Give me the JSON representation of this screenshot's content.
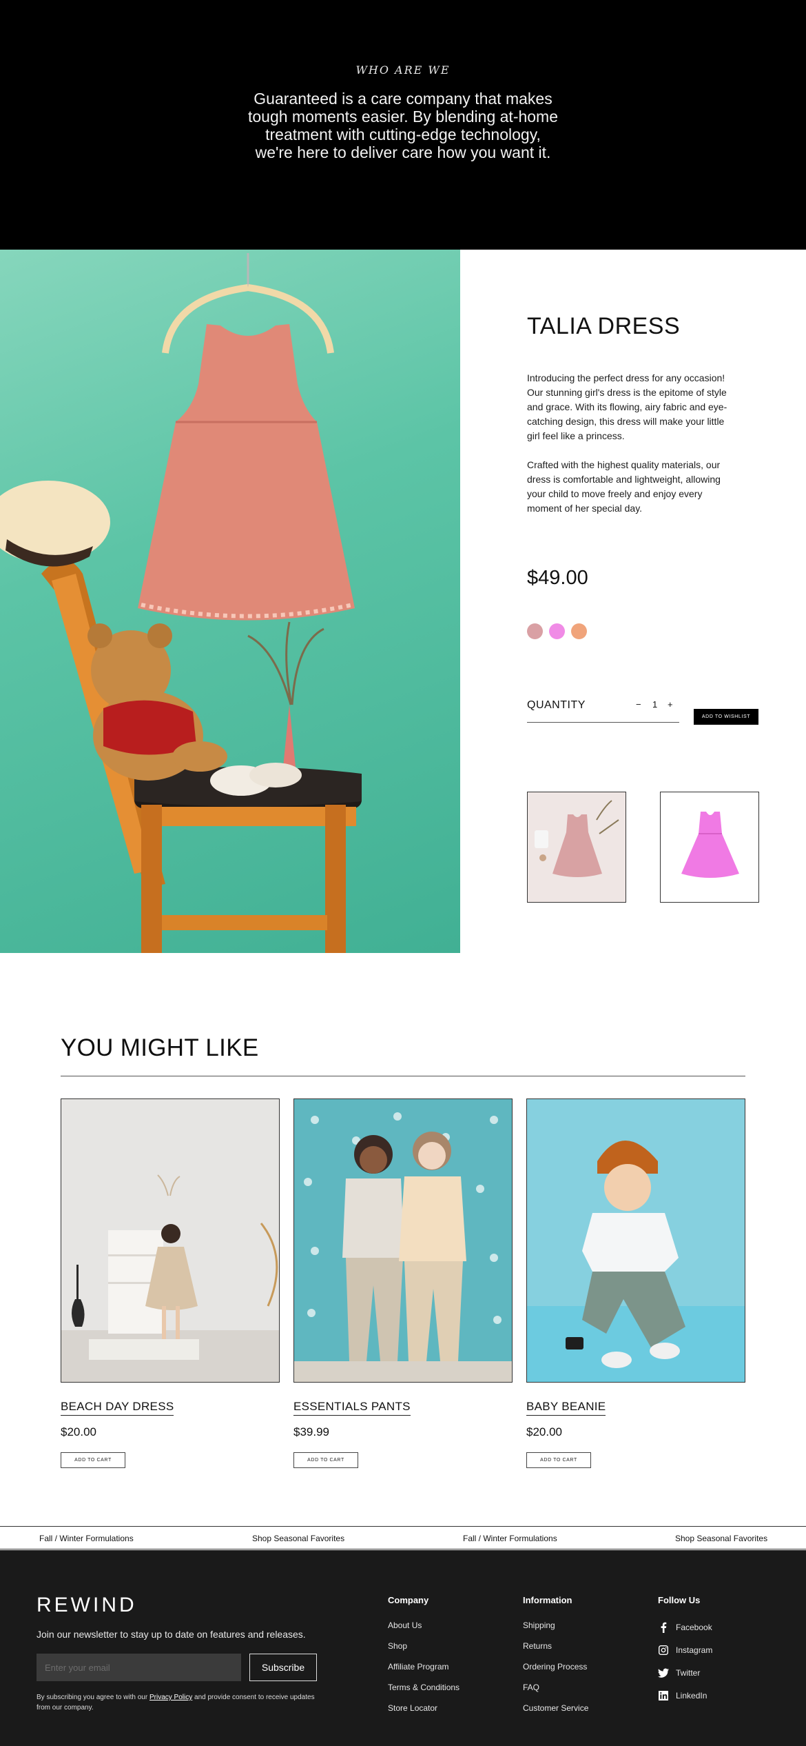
{
  "hero": {
    "eyebrow": "WHO ARE WE",
    "lead": "Guaranteed is a care company that makes tough moments easier. By blending at-home treatment with cutting-edge technology, we're here to deliver care how you want it."
  },
  "product": {
    "title": "TALIA DRESS",
    "description": [
      "Introducing the perfect dress for any occasion! Our stunning girl's dress is the epitome of style and grace. With its flowing, airy fabric and eye-catching design, this dress will make your little girl feel like a princess.",
      "Crafted with the highest quality materials, our dress is comfortable and lightweight, allowing your child to move freely and enjoy every moment of her special day."
    ],
    "price": "$49.00",
    "swatches": [
      "#d9a0a4",
      "#f08be6",
      "#f0a47b"
    ],
    "quantity_label": "QUANTITY",
    "quantity_minus": "−",
    "quantity_value": "1",
    "quantity_plus": "+",
    "wishlist_label": "ADD TO WISHLIST"
  },
  "recommended": {
    "title": "YOU MIGHT LIKE",
    "items": [
      {
        "name": "BEACH DAY DRESS",
        "price": "$20.00",
        "cta": "ADD TO CART"
      },
      {
        "name": "ESSENTIALS PANTS",
        "price": "$39.99",
        "cta": "ADD TO CART"
      },
      {
        "name": "BABY BEANIE",
        "price": "$20.00",
        "cta": "ADD TO CART"
      }
    ]
  },
  "marquee": [
    "Fall / Winter Formulations",
    "Shop Seasonal Favorites",
    "Fall / Winter Formulations",
    "Shop Seasonal Favorites"
  ],
  "footer": {
    "logo": "REWIND",
    "newsletter_text": "Join our newsletter to stay up to date on features and releases.",
    "email_placeholder": "Enter your email",
    "subscribe_label": "Subscribe",
    "consent_before": "By subscribing you agree to with our ",
    "consent_link": "Privacy Policy",
    "consent_after": " and provide consent to receive updates from our company.",
    "columns": [
      {
        "title": "Company",
        "links": [
          "About Us",
          "Shop",
          "Affiliate Program",
          "Terms & Conditions",
          "Store Locator"
        ]
      },
      {
        "title": "Information",
        "links": [
          "Shipping",
          "Returns",
          "Ordering Process",
          "FAQ",
          "Customer Service"
        ]
      }
    ],
    "social": {
      "title": "Follow Us",
      "links": [
        {
          "label": "Facebook",
          "icon": "facebook-icon"
        },
        {
          "label": "Instagram",
          "icon": "instagram-icon"
        },
        {
          "label": "Twitter",
          "icon": "twitter-icon"
        },
        {
          "label": "LinkedIn",
          "icon": "linkedin-icon"
        }
      ]
    }
  },
  "colors": {
    "hero_bg": "#000000",
    "footer_bg": "#1a1a1a",
    "product_photo_bg": "#5cc4a6"
  }
}
